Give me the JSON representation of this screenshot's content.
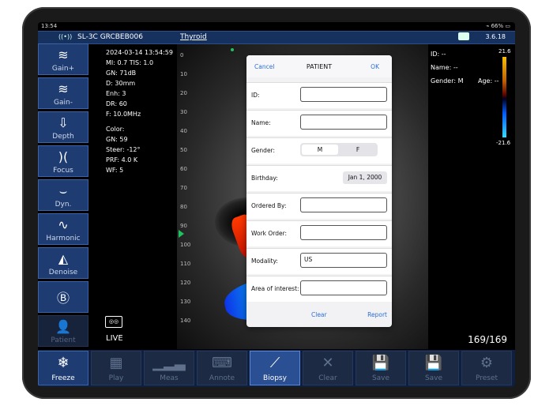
{
  "status": {
    "time": "13:54",
    "battery": "66%"
  },
  "header": {
    "device": "SL-3C GRCBEB006",
    "preset": "Thyroid",
    "version": "3.6.18"
  },
  "toolbar_left": [
    {
      "label": "Gain+",
      "icon": "gain-plus-icon",
      "enabled": true
    },
    {
      "label": "Gain-",
      "icon": "gain-minus-icon",
      "enabled": true
    },
    {
      "label": "Depth",
      "icon": "depth-icon",
      "enabled": true
    },
    {
      "label": "Focus",
      "icon": "focus-icon",
      "enabled": true
    },
    {
      "label": "Dyn.",
      "icon": "dynamic-range-icon",
      "enabled": true
    },
    {
      "label": "Harmonic",
      "icon": "harmonic-icon",
      "enabled": true
    },
    {
      "label": "Denoise",
      "icon": "denoise-icon",
      "enabled": true
    },
    {
      "label": "",
      "icon": "b-mode-icon",
      "enabled": true
    },
    {
      "label": "Patient",
      "icon": "patient-icon",
      "enabled": false
    }
  ],
  "params": [
    "2024-03-14 13:54:59",
    "MI: 0.7  TIS: 1.0",
    "GN: 71dB",
    "D: 30mm",
    "Enh: 3",
    "DR: 60",
    "F: 10.0MHz",
    "",
    "Color:",
    "GN: 59",
    "Steer: -12°",
    "PRF: 4.0 K",
    "WF: 5"
  ],
  "depth_scale": [
    "0",
    "10",
    "20",
    "30",
    "40",
    "50",
    "60",
    "70",
    "80",
    "90",
    "100",
    "110",
    "120",
    "130",
    "140"
  ],
  "live_label": "LIVE",
  "frame_counter": "169/169",
  "patient_info": {
    "id": "ID: --",
    "name": "Name: --",
    "gender": "Gender: M",
    "age": "Age: --"
  },
  "color_scale": {
    "top": "21.6",
    "bottom": "-21.6"
  },
  "toolbar_bottom": [
    {
      "label": "Freeze",
      "icon": "snowflake-icon",
      "enabled": true
    },
    {
      "label": "Play",
      "icon": "film-icon",
      "enabled": false
    },
    {
      "label": "Meas",
      "icon": "ruler-icon",
      "enabled": false
    },
    {
      "label": "Annote",
      "icon": "keyboard-icon",
      "enabled": false
    },
    {
      "label": "Biopsy",
      "icon": "biopsy-icon",
      "enabled": true
    },
    {
      "label": "Clear",
      "icon": "clear-x-icon",
      "enabled": false
    },
    {
      "label": "Save",
      "icon": "save-image-icon",
      "enabled": false
    },
    {
      "label": "Save",
      "icon": "save-video-icon",
      "enabled": false
    },
    {
      "label": "Preset",
      "icon": "gear-icon",
      "enabled": false
    }
  ],
  "dialog": {
    "title": "PATIENT",
    "cancel": "Cancel",
    "ok": "OK",
    "fields": {
      "id_label": "ID:",
      "name_label": "Name:",
      "gender_label": "Gender:",
      "gender_m": "M",
      "gender_f": "F",
      "birthday_label": "Birthday:",
      "birthday_value": "Jan 1, 2000",
      "ordered_by_label": "Ordered By:",
      "work_order_label": "Work Order:",
      "modality_label": "Modality:",
      "modality_value": "US",
      "area_label": "Area of interest:"
    },
    "clear": "Clear",
    "report": "Report"
  }
}
